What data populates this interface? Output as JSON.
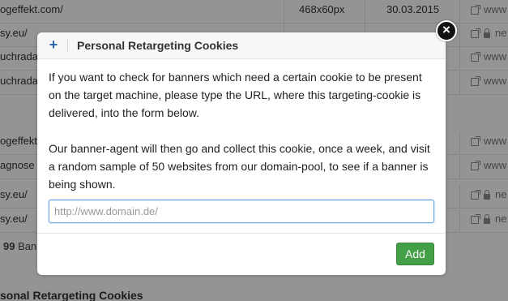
{
  "background": {
    "rows": [
      {
        "domain": "ogeffekt.com/",
        "size": "468x60px",
        "date": "30.03.2015",
        "actions": "www"
      },
      {
        "domain": "sy.eu/",
        "size": "",
        "date": "",
        "actions": "ne"
      },
      {
        "domain": "uchrada",
        "size": "",
        "date": "",
        "actions": "www"
      },
      {
        "domain": "uchrada",
        "size": "",
        "date": "",
        "actions": "www"
      },
      {
        "domain": "ogeffekt.com/",
        "size": "",
        "date": "",
        "actions": "www"
      },
      {
        "domain": "agnose",
        "size": "",
        "date": "",
        "actions": "www"
      },
      {
        "domain": "sy.eu/",
        "size": "",
        "date": "",
        "actions": "ne"
      },
      {
        "domain": "sy.eu/",
        "size": "",
        "date": "",
        "actions": "ne"
      }
    ],
    "footer_count": "99",
    "footer_text": "Ban",
    "section_title": "sonal Retargeting Cookies"
  },
  "modal": {
    "title": "Personal Retargeting Cookies",
    "paragraph1": "If you want to check for banners which need a certain cookie to be present on the target machine, please type the URL, where this targeting-cookie is delivered, into the form below.",
    "paragraph2": "Our banner-agent will then go and collect this cookie, once a week, and visit a random sample of 50 websites from our domain-pool, to see if a banner is being shown.",
    "input": {
      "value": "",
      "placeholder": "http://www.domain.de/"
    },
    "add_label": "Add"
  },
  "colors": {
    "accent": "#2f67b3",
    "add_button": "#43a047"
  },
  "icons": {
    "header": "plus-icon",
    "close": "close-icon",
    "row_link": "external-link-icon",
    "row_lock": "lock-icon"
  }
}
